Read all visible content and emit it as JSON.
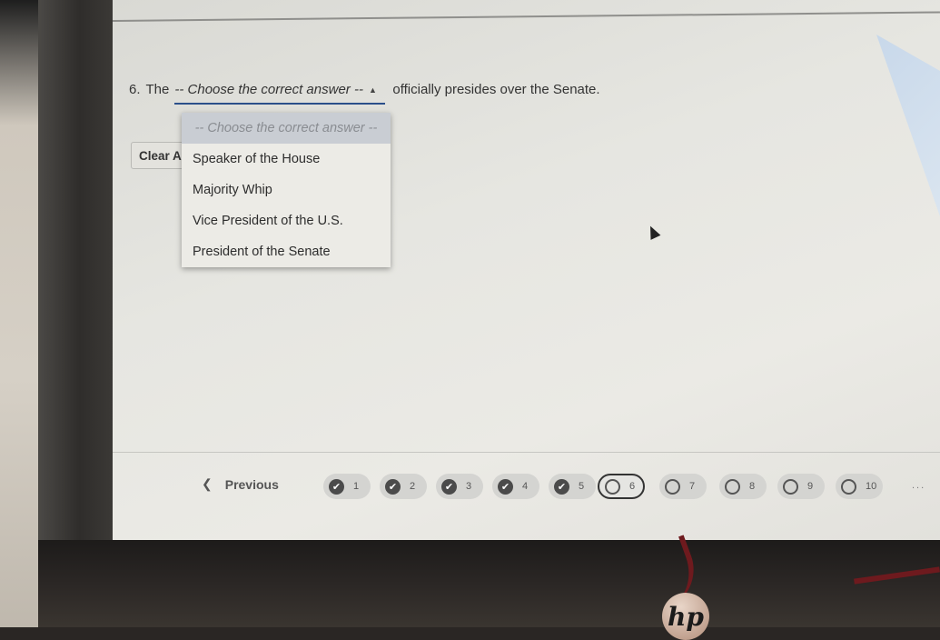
{
  "question": {
    "number": "6.",
    "prefix": "The",
    "select_value": "-- Choose the correct answer --",
    "suffix": "officially presides over the Senate."
  },
  "dropdown": {
    "placeholder": "-- Choose the correct answer --",
    "options": [
      "Speaker of the House",
      "Majority Whip",
      "Vice President of the U.S.",
      "President of the Senate"
    ]
  },
  "clear_button": "Clear A",
  "nav": {
    "previous_label": "Previous",
    "chevron": "❮",
    "questions": [
      {
        "label": "1",
        "status": "answered"
      },
      {
        "label": "2",
        "status": "answered"
      },
      {
        "label": "3",
        "status": "answered"
      },
      {
        "label": "4",
        "status": "answered"
      },
      {
        "label": "5",
        "status": "answered"
      },
      {
        "label": "6",
        "status": "current"
      },
      {
        "label": "7",
        "status": "unanswered"
      },
      {
        "label": "8",
        "status": "unanswered"
      },
      {
        "label": "9",
        "status": "unanswered"
      },
      {
        "label": "10",
        "status": "unanswered"
      }
    ],
    "ellipsis": "..."
  },
  "brand": "hp",
  "colors": {
    "select_underline": "#2b4f8a",
    "answered_icon": "#4b4b4b"
  }
}
